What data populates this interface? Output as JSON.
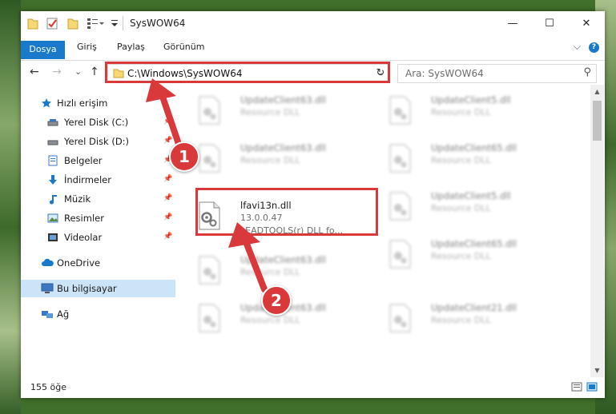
{
  "window": {
    "title": "SysWOW64",
    "controls": {
      "minimize": "—",
      "maximize": "☐",
      "close": "✕"
    }
  },
  "ribbon": {
    "tabs": [
      "Dosya",
      "Giriş",
      "Paylaş",
      "Görünüm"
    ],
    "active_tab": "Dosya",
    "collapse": "⌵",
    "help": "?"
  },
  "navigation": {
    "back": "←",
    "forward": "→",
    "recent": "⌄",
    "up": "↑",
    "address_path": "C:\\Windows\\SysWOW64",
    "address_dropdown": "⌄",
    "refresh": "↻",
    "search_placeholder": "Ara: SysWOW64",
    "search_icon": "⚲"
  },
  "sidebar": {
    "items": [
      {
        "label": "Hızlı erişim",
        "icon": "star-icon",
        "pinned": false
      },
      {
        "label": "Yerel Disk (C:)",
        "icon": "drive-icon",
        "pinned": true
      },
      {
        "label": "Yerel Disk (D:)",
        "icon": "drive-icon",
        "pinned": true
      },
      {
        "label": "Belgeler",
        "icon": "documents-icon",
        "pinned": true
      },
      {
        "label": "İndirmeler",
        "icon": "download-icon",
        "pinned": true
      },
      {
        "label": "Müzik",
        "icon": "music-icon",
        "pinned": true
      },
      {
        "label": "Resimler",
        "icon": "pictures-icon",
        "pinned": true
      },
      {
        "label": "Videolar",
        "icon": "video-icon",
        "pinned": true
      },
      {
        "label": "OneDrive",
        "icon": "cloud-icon",
        "pinned": false
      },
      {
        "label": "Bu bilgisayar",
        "icon": "computer-icon",
        "pinned": false,
        "selected": true
      },
      {
        "label": "Ağ",
        "icon": "network-icon",
        "pinned": false
      }
    ],
    "pin_glyph": "📌"
  },
  "files": {
    "highlighted": {
      "name": "lfavi13n.dll",
      "version": "13.0.0.47",
      "description": "LEADTOOLS(r) DLL fo..."
    },
    "blurred": [
      {
        "name": "UpdateClient63.dll",
        "desc": "Resource DLL"
      },
      {
        "name": "UpdateClient5.dll",
        "desc": "Resource DLL"
      },
      {
        "name": "UpdateClient63.dll",
        "desc": "Resource DLL"
      },
      {
        "name": "UpdateClient65.dll",
        "desc": "Resource DLL"
      },
      {
        "name": "UpdateClient5.dll",
        "desc": "Resource DLL"
      },
      {
        "name": "UpdateClient63.dll",
        "desc": "Resource DLL"
      },
      {
        "name": "UpdateClient65.dll",
        "desc": "Resource DLL"
      },
      {
        "name": "UpdateClient63.dll",
        "desc": "Resource DLL"
      },
      {
        "name": "UpdateClient21.dll",
        "desc": "Resource DLL"
      }
    ]
  },
  "status": {
    "item_count": "155 öğe"
  },
  "annotations": {
    "badge1": "1",
    "badge2": "2",
    "color": "#d9393a"
  },
  "colors": {
    "accent": "#1979ca",
    "selection": "#cce4f7",
    "annotation": "#d9393a"
  }
}
